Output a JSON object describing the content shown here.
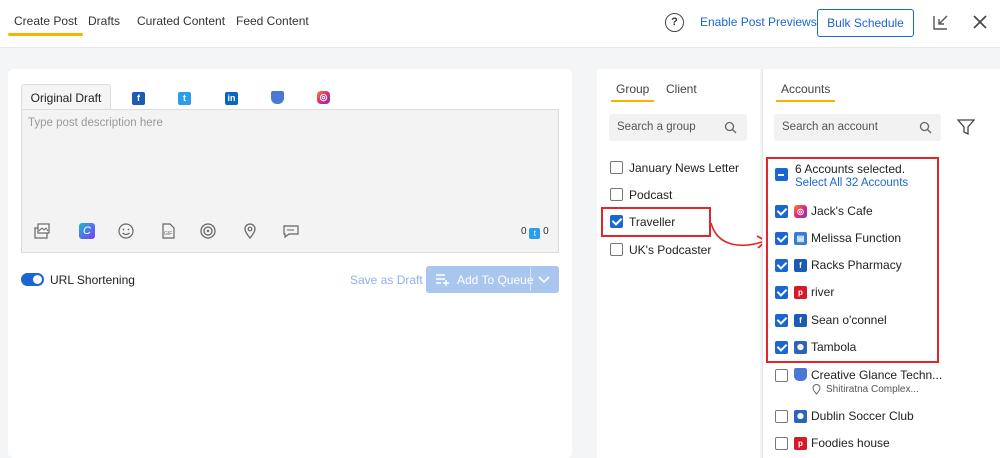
{
  "nav": {
    "tabs": [
      "Create Post",
      "Drafts",
      "Curated Content",
      "Feed Content"
    ],
    "help": "?",
    "enable_previews": "Enable Post Previews",
    "bulk_schedule": "Bulk Schedule"
  },
  "editor": {
    "tab_original": "Original Draft",
    "placeholder": "Type post description here",
    "counter_a": "0",
    "counter_b": "0",
    "url_shortening": "URL Shortening",
    "save_draft": "Save as Draft",
    "add_queue": "Add To Queue"
  },
  "groups": {
    "tabs": [
      "Group",
      "Client"
    ],
    "search_placeholder": "Search a group",
    "items": [
      {
        "label": "January News Letter",
        "checked": false
      },
      {
        "label": "Podcast",
        "checked": false
      },
      {
        "label": "Traveller",
        "checked": true
      },
      {
        "label": "UK's Podcaster",
        "checked": false
      }
    ]
  },
  "accounts": {
    "tab": "Accounts",
    "search_placeholder": "Search an account",
    "selected_text": "6 Accounts selected.",
    "select_all": "Select All 32 Accounts",
    "items": [
      {
        "label": "Jack's Cafe",
        "icon": "instagram-icon",
        "checked": true
      },
      {
        "label": "Melissa Function",
        "icon": "business-icon",
        "checked": true
      },
      {
        "label": "Racks Pharmacy",
        "icon": "facebook-icon",
        "checked": true
      },
      {
        "label": "river",
        "icon": "pinterest-icon",
        "checked": true
      },
      {
        "label": "Sean o'connel",
        "icon": "facebook-icon",
        "checked": true
      },
      {
        "label": "Tambola",
        "icon": "group-icon",
        "checked": true
      },
      {
        "label": "Creative Glance Techn...",
        "sub": "Shitiratna Complex...",
        "icon": "google-business-icon",
        "checked": false
      },
      {
        "label": "Dublin Soccer Club",
        "icon": "group-icon",
        "checked": false
      },
      {
        "label": "Foodies house",
        "icon": "pinterest-icon",
        "checked": false
      }
    ]
  },
  "colors": {
    "accent": "#1a66d2",
    "highlight": "#e3262a",
    "tab_underline": "#f4b400"
  }
}
